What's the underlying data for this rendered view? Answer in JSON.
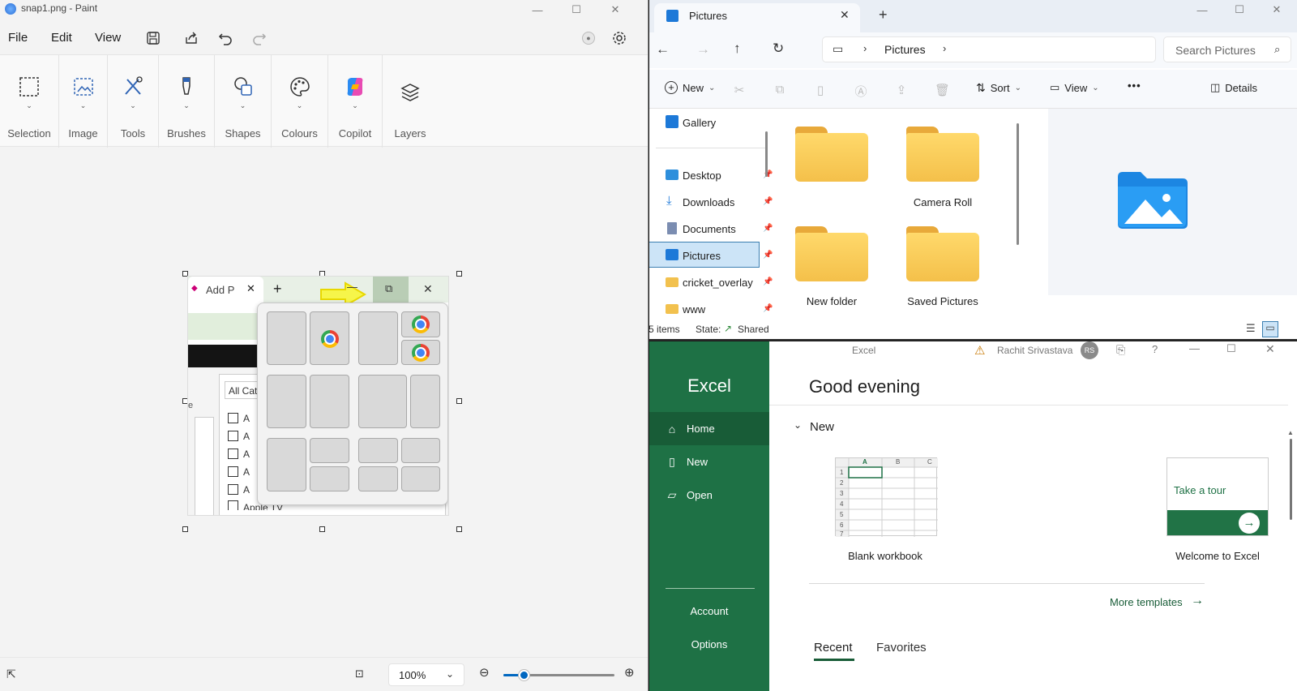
{
  "paint": {
    "title": "snap1.png - Paint",
    "menus": [
      "File",
      "Edit",
      "View"
    ],
    "ribbon_groups": [
      "Selection",
      "Image",
      "Tools",
      "Brushes",
      "Shapes",
      "Colours",
      "Copilot",
      "Layers"
    ],
    "snap": {
      "tab_label": "Add P",
      "filter_label": "All Cat",
      "list_items": [
        "A",
        "A",
        "A",
        "A",
        "A"
      ],
      "bottom_item": "Apple TV",
      "side_letter": "e"
    },
    "zoom": "100%",
    "zoom_slider_value": 0.18
  },
  "explorer": {
    "tab_title": "Pictures",
    "breadcrumb": [
      "Pictures"
    ],
    "search_placeholder": "Search Pictures",
    "toolbar": {
      "new": "New",
      "sort": "Sort",
      "view": "View",
      "more": "•••",
      "details": "Details"
    },
    "nav": [
      {
        "label": "Gallery",
        "icon": "gallery-icon",
        "pinned": false
      },
      {
        "label": "Desktop",
        "icon": "desktop-folder-icon",
        "pinned": true
      },
      {
        "label": "Downloads",
        "icon": "downloads-icon",
        "pinned": true
      },
      {
        "label": "Documents",
        "icon": "documents-icon",
        "pinned": true
      },
      {
        "label": "Pictures",
        "icon": "pictures-icon",
        "pinned": true,
        "selected": true
      },
      {
        "label": "cricket_overlay",
        "icon": "folder-icon",
        "pinned": true
      },
      {
        "label": "www",
        "icon": "folder-icon",
        "pinned": true
      }
    ],
    "folders": [
      "",
      "Camera Roll",
      "New folder",
      "Saved Pictures"
    ],
    "status": {
      "items": "5 items",
      "state_label": "State:",
      "state_value": "Shared"
    }
  },
  "excel": {
    "window_title": "Excel",
    "user_name": "Rachit Srivastava",
    "user_initials": "RS",
    "brand": "Excel",
    "nav": {
      "home": "Home",
      "new": "New",
      "open": "Open",
      "account": "Account",
      "options": "Options"
    },
    "greeting": "Good evening",
    "new_section": "New",
    "templates": {
      "blank": "Blank workbook",
      "tour_card": "Take a tour",
      "tour": "Welcome to Excel"
    },
    "grid_cols": [
      "A",
      "B",
      "C"
    ],
    "grid_rows": [
      "1",
      "2",
      "3",
      "4",
      "5",
      "6",
      "7"
    ],
    "more_templates": "More templates",
    "tabs": {
      "recent": "Recent",
      "favorites": "Favorites"
    },
    "colors": {
      "brand_green": "#1e7145",
      "active_green": "#185c37"
    }
  }
}
